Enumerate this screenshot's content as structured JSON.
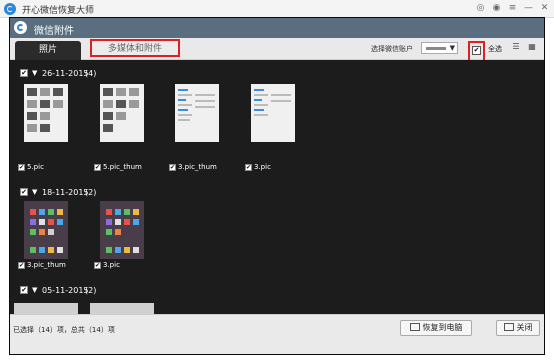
{
  "app": {
    "title": "开心微信恢复大师"
  },
  "window_controls": [
    {
      "name": "weibo-icon",
      "glyph": "◎"
    },
    {
      "name": "chat-icon",
      "glyph": "◉"
    },
    {
      "name": "menu-icon",
      "glyph": "≡"
    },
    {
      "name": "minimize-icon",
      "glyph": "—"
    },
    {
      "name": "close-icon",
      "glyph": "✕"
    }
  ],
  "dialog": {
    "title": "微信附件",
    "tabs": [
      {
        "label": "照片"
      },
      {
        "label": "多媒体和附件"
      }
    ],
    "account_label": "选择微信账户",
    "select_all_label": "全选",
    "groups": [
      {
        "date": "26-11-2015",
        "count": "(4)",
        "items": [
          {
            "label": "5.pic"
          },
          {
            "label": "5.pic_thum"
          },
          {
            "label": "3.pic_thum"
          },
          {
            "label": "3.pic"
          }
        ]
      },
      {
        "date": "18-11-2015",
        "count": "(2)",
        "items": [
          {
            "label": "3.pic_thum"
          },
          {
            "label": "3.pic"
          }
        ]
      },
      {
        "date": "05-11-2015",
        "count": "(2)",
        "items": []
      }
    ],
    "status": "已选择（14）项，总共（14）项",
    "recover_button": "恢复到电脑",
    "close_button": "关闭"
  },
  "colors": {
    "dialog_title_bar": "#5a6e80",
    "content_bg": "#1c1c1c",
    "highlight_border": "#e02020",
    "brand_blue": "#2d86d6"
  }
}
